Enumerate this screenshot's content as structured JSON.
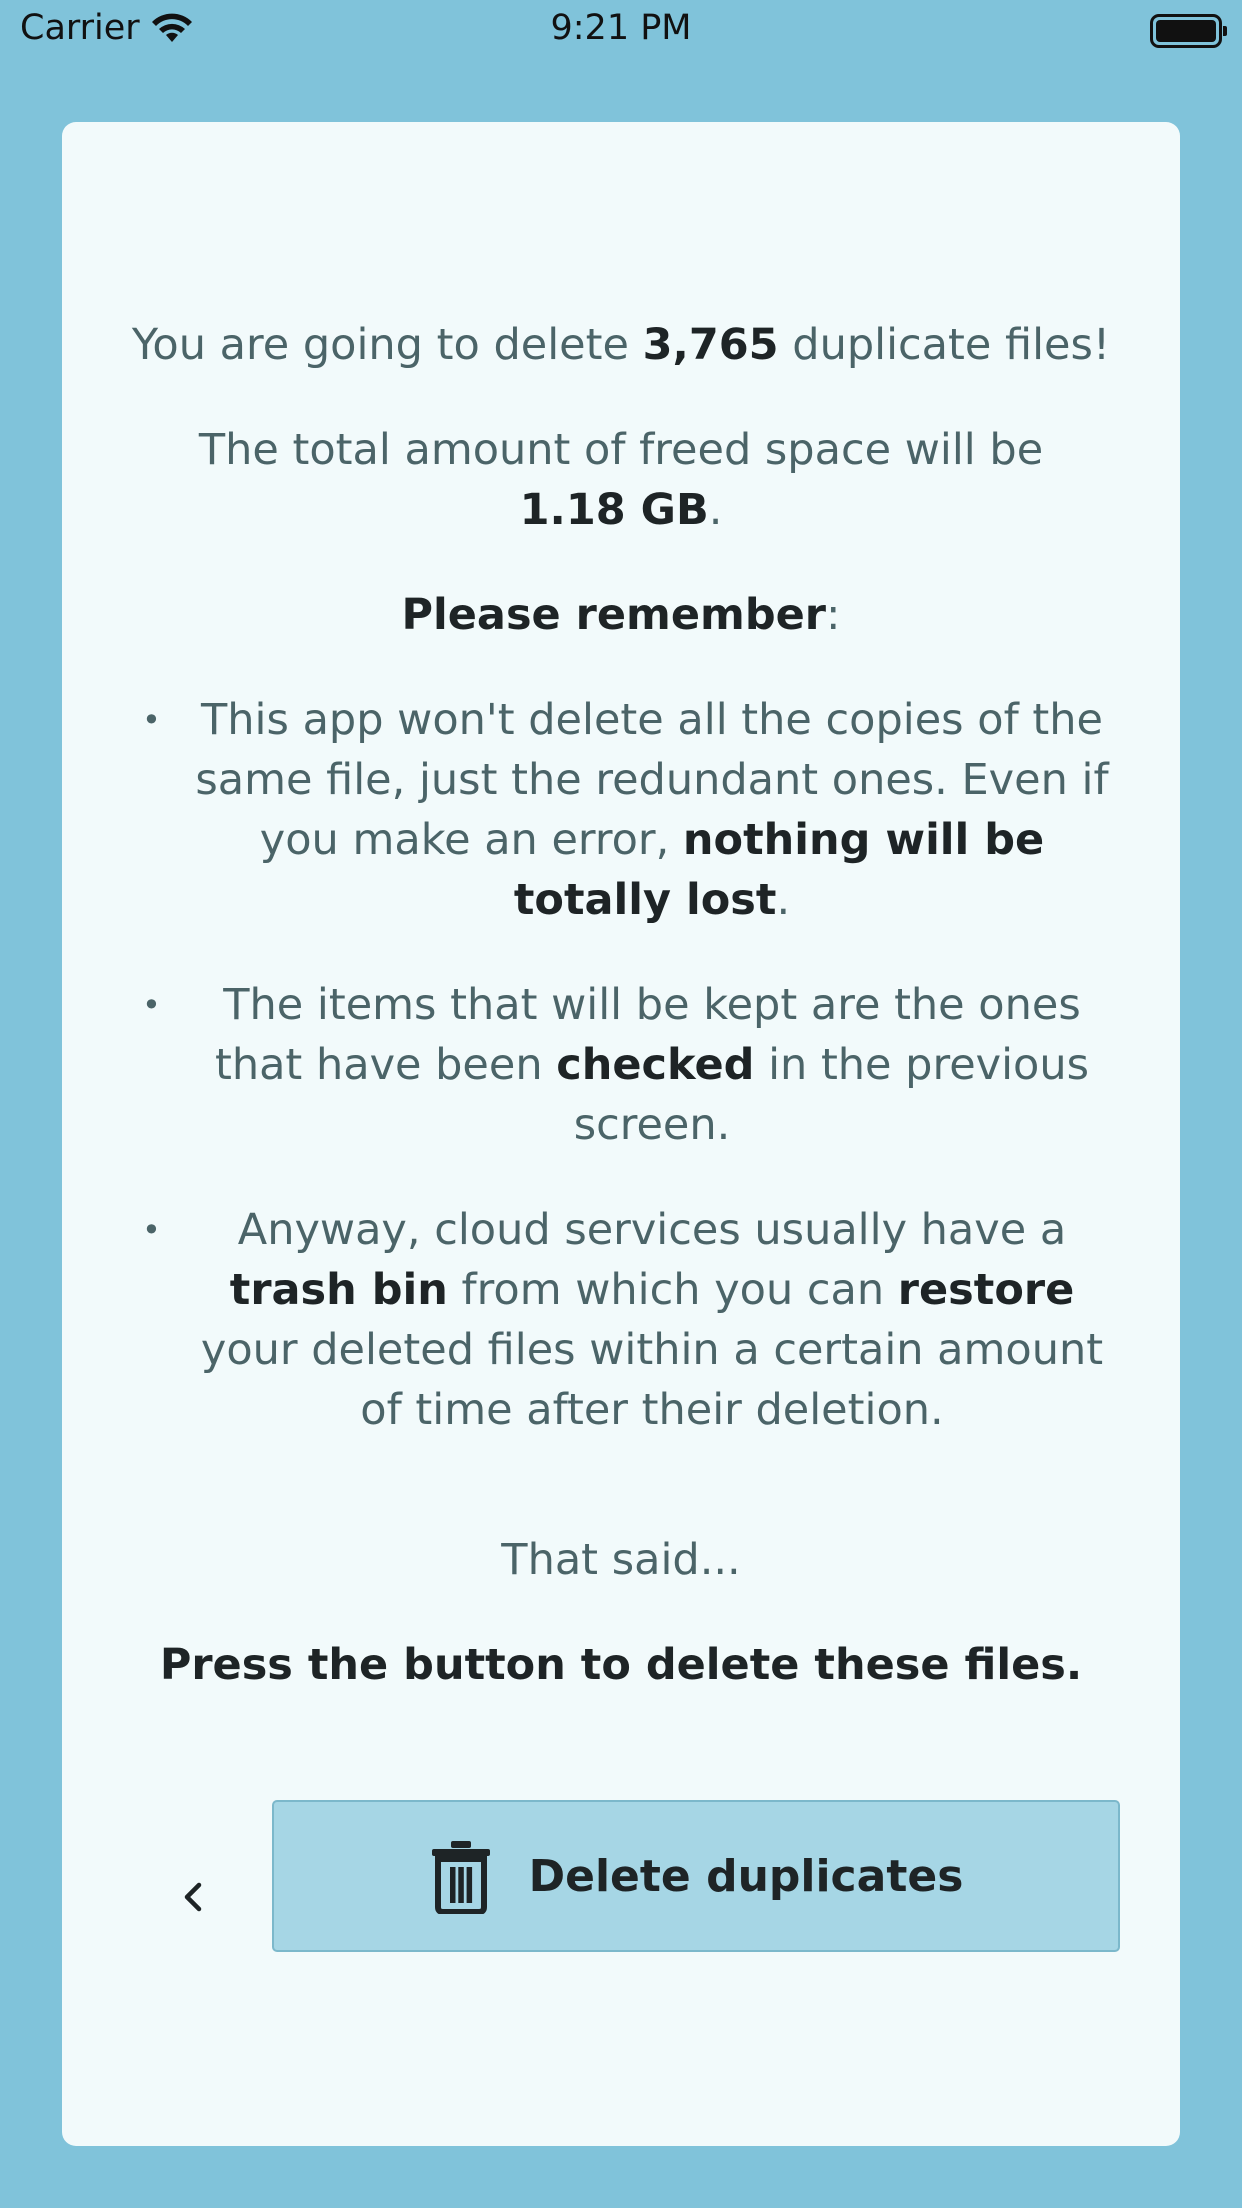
{
  "status_bar": {
    "carrier": "Carrier",
    "time": "9:21 PM"
  },
  "summary": {
    "count_prefix": "You are going to delete ",
    "count": "3,765",
    "count_suffix": " duplicate files!",
    "total_prefix": "The total amount of freed space will be",
    "total_size": "1.18 GB",
    "total_suffix": "."
  },
  "remember": {
    "heading": "Please remember",
    "heading_suffix": ":",
    "bullet_symbol": "•",
    "items": [
      {
        "text_1": "This app won't delete all the copies of the same file, just the redundant ones. Even if you make an error, ",
        "bold_1": "nothing will be totally lost",
        "text_2": "."
      },
      {
        "text_1": "The items that will be kept are the ones that have been ",
        "bold_1": "checked",
        "text_2": " in the previous screen."
      },
      {
        "text_1": "Anyway, cloud services usually have a ",
        "bold_1": "trash bin",
        "text_2": " from which you can ",
        "bold_2": "restore",
        "text_3": " your deleted files within a certain amount of time after their deletion."
      }
    ]
  },
  "closing": {
    "that_said": "That said...",
    "instruction": "Press the button to delete these files."
  },
  "actions": {
    "back_icon": "chevron-left-icon",
    "delete_icon": "trash-icon",
    "delete_label": "Delete duplicates"
  },
  "colors": {
    "background": "#80c3da",
    "card": "#f2fafb",
    "button": "#a6d6e5",
    "text": "#4b6468",
    "emphasis": "#1e2426"
  }
}
